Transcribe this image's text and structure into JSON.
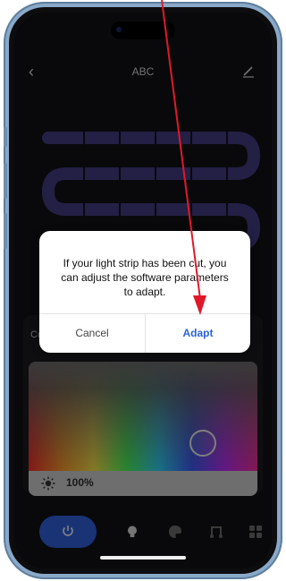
{
  "header": {
    "title": "ABC",
    "back_icon": "chevron-left-icon",
    "edit_icon": "pencil-icon"
  },
  "panel": {
    "label_partial": "Co"
  },
  "brightness": {
    "value": "100%",
    "icon": "sun-icon"
  },
  "dialog": {
    "message": "If your light strip has been cut, you can adjust the software parameters to adapt.",
    "cancel_label": "Cancel",
    "adapt_label": "Adapt"
  },
  "dock": {
    "items": [
      {
        "icon": "power-icon",
        "active": true
      },
      {
        "icon": "bulb-icon"
      },
      {
        "icon": "palette-icon"
      },
      {
        "icon": "music-icon"
      },
      {
        "icon": "grid-icon"
      }
    ]
  },
  "colors": {
    "accent": "#2b64d9",
    "power_active": "#2f5ed6",
    "annotation_arrow": "#e0192a",
    "strip": "#6c5bd6"
  }
}
